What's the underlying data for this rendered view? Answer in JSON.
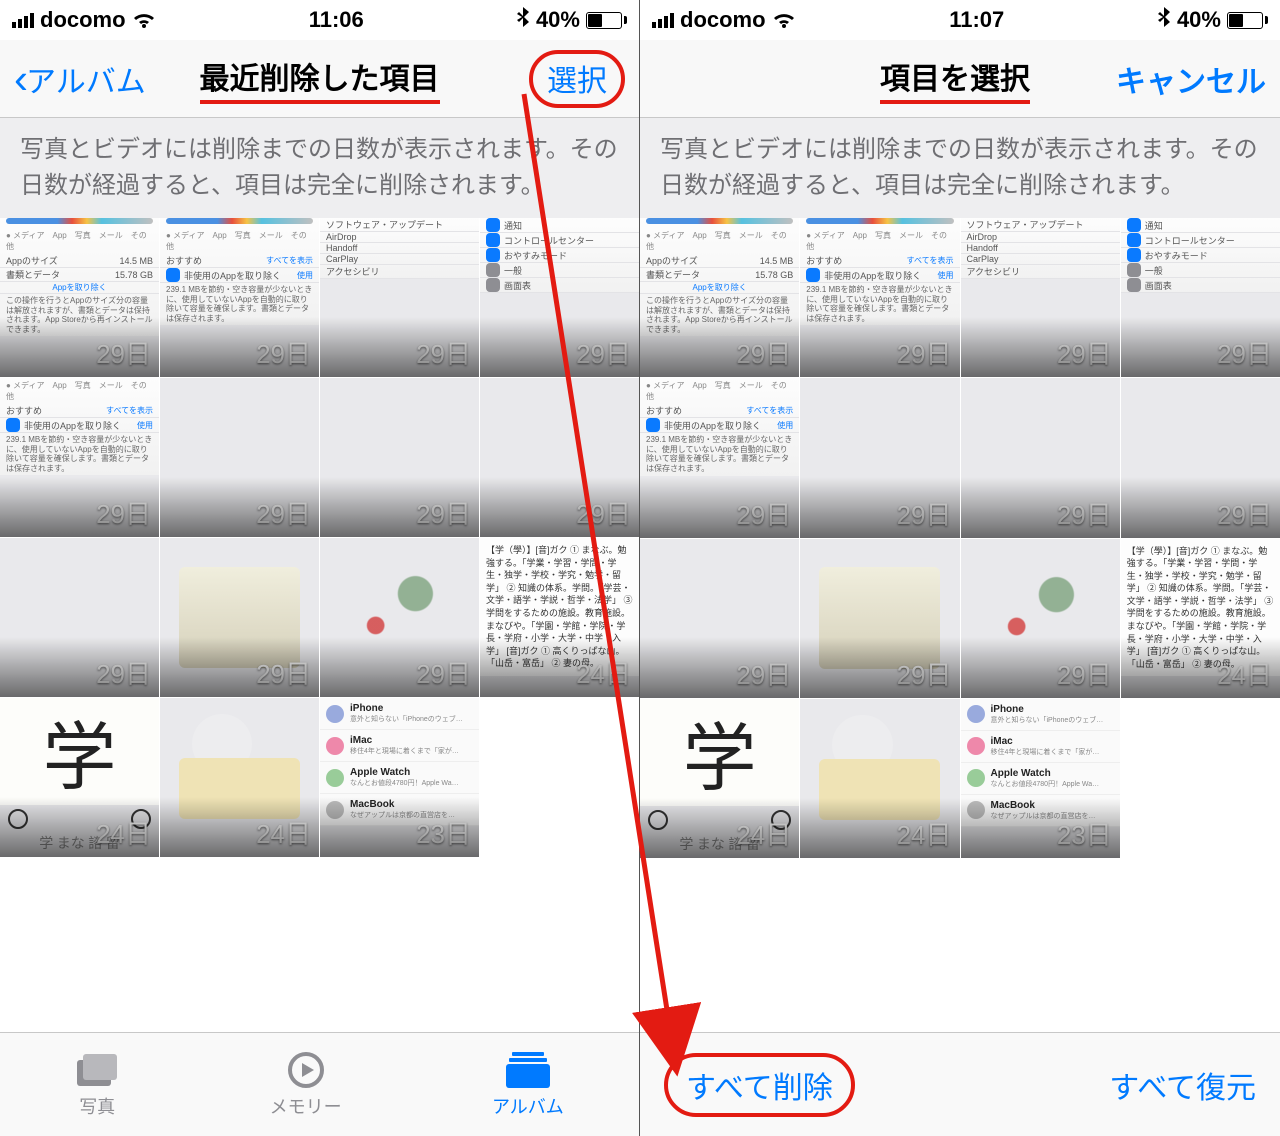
{
  "left": {
    "status": {
      "carrier": "docomo",
      "time": "11:06",
      "battery": "40%"
    },
    "nav": {
      "back": "アルバム",
      "title": "最近削除した項目",
      "select": "選択"
    },
    "banner": "写真とビデオには削除までの日数が表示されます。その日数が経過すると、項目は完全に削除されます。",
    "tabs": {
      "photos": "写真",
      "memories": "メモリー",
      "albums": "アルバム"
    }
  },
  "right": {
    "status": {
      "carrier": "docomo",
      "time": "11:07",
      "battery": "40%"
    },
    "nav": {
      "title": "項目を選択",
      "cancel": "キャンセル"
    },
    "banner": "写真とビデオには削除までの日数が表示されます。その日数が経過すると、項目は完全に削除されます。",
    "toolbar": {
      "delete_all": "すべて削除",
      "recover_all": "すべて復元"
    }
  },
  "thumbs": [
    {
      "days": "29日",
      "t": "settings-a"
    },
    {
      "days": "29日",
      "t": "settings-b"
    },
    {
      "days": "29日",
      "t": "settings-c"
    },
    {
      "days": "29日",
      "t": "settings-d"
    },
    {
      "days": "29日",
      "t": "settings-e"
    },
    {
      "days": "29日",
      "t": "photo-garden"
    },
    {
      "days": "29日",
      "t": "photo-paper"
    },
    {
      "days": "29日",
      "t": "photo-scene"
    },
    {
      "days": "29日",
      "t": "photo-stone"
    },
    {
      "days": "29日",
      "t": "photo-book"
    },
    {
      "days": "29日",
      "t": "photo-map"
    },
    {
      "days": "24日",
      "t": "text-dict"
    },
    {
      "days": "24日",
      "t": "kanji"
    },
    {
      "days": "24日",
      "t": "kitty"
    },
    {
      "days": "23日",
      "t": "devices"
    }
  ],
  "mini": {
    "app_size_label": "Appのサイズ",
    "app_size_val": "14.5 MB",
    "doc_data_label": "書類とデータ",
    "doc_data_val": "15.78 GB",
    "offload": "Appを取り除く",
    "recommend": "おすすめ",
    "show_all": "すべてを表示",
    "unused": "非使用のAppを取り除く",
    "use": "使用",
    "tiny": "239.1 MBを節約・空き容量が少ないときに、使用していないAppを自動的に取り除いて容量を確保します。書類とデータは保存されます。",
    "legend": "メディア　App　写真　メール　その他",
    "settings_items": [
      "ソフトウェア・アップデート",
      "AirDrop",
      "Handoff",
      "CarPlay",
      "アクセシビリ"
    ],
    "settings_items2": [
      "通知",
      "コントロールセンター",
      "おやすみモード",
      "一般",
      "画面表"
    ],
    "dict": "【学（學）】[音]ガク\n① まなぶ。勉強する。「学業・学習・学問・学生・独学・学校・学究・勉学・留学」\n② 知識の体系。学問。「学芸・文学・語学・学説・哲学・法学」\n③ 学問をするための施設。教育施設。まなびや。「学園・学館・学院・学長・学府・小学・大学・中学・入学」\n[音]ガク\n① 高くりっぱな山。「山岳・富岳」\n② 妻の母。",
    "kanji": "学",
    "kanji_sub": "学 まな  諮 留",
    "devices": [
      {
        "name": "iPhone",
        "sub": "意外と知らない「iPhoneのウェブ…"
      },
      {
        "name": "iMac",
        "sub": "移住4年と現場に着くまで「家が…"
      },
      {
        "name": "Apple Watch",
        "sub": "なんとお値段4780円！Apple Wa…"
      },
      {
        "name": "MacBook",
        "sub": "なぜアップルは京都の直営店を…"
      }
    ]
  }
}
